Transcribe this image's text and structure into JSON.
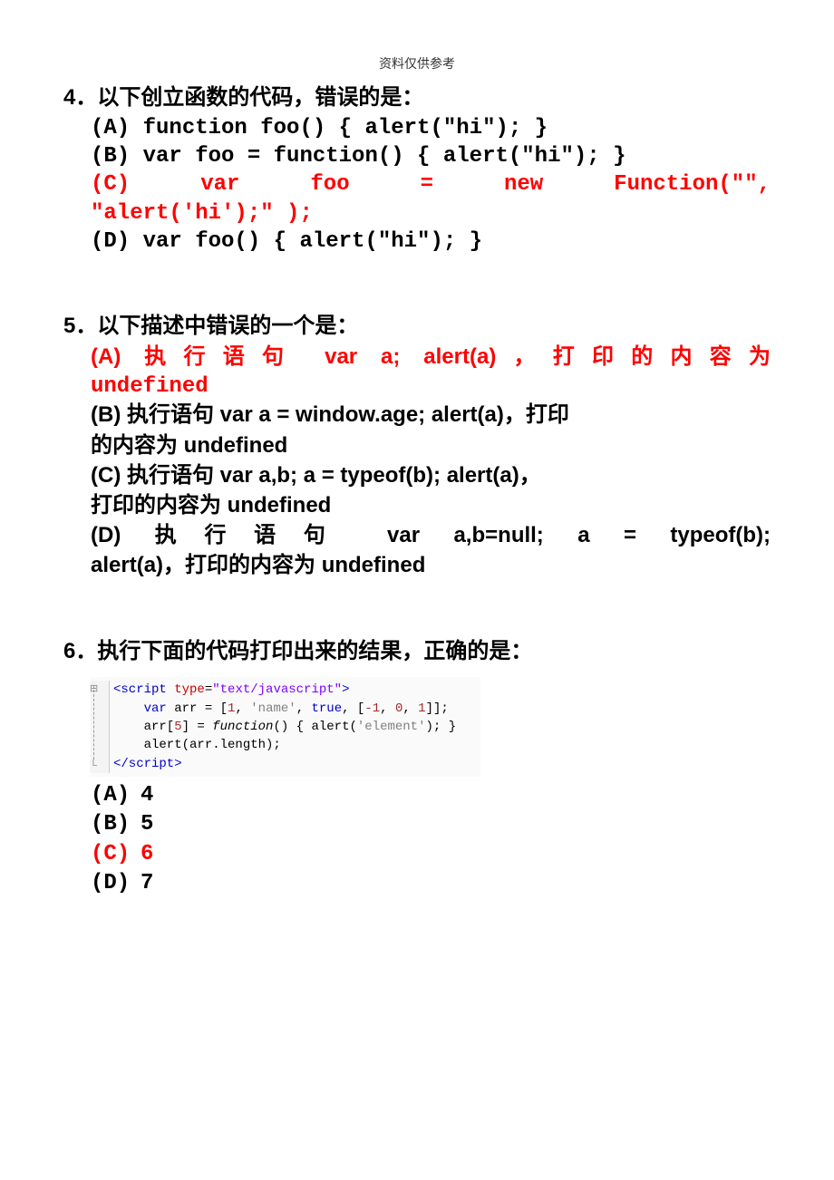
{
  "header": "资料仅供参考",
  "q4": {
    "title": "4．以下创立函数的代码，错误的是：",
    "A": "(A) function foo() { alert(\"hi\"); }",
    "B": "(B) var foo = function() { alert(\"hi\"); }",
    "C1": "(C)  var  foo  =  new  Function(\"\",",
    "C2": "\"alert('hi');\" );",
    "D": "(D) var foo() { alert(\"hi\"); }"
  },
  "q5": {
    "title": "5．以下描述中错误的一个是：",
    "A_pre": "(A) 执行语句 var a; alert(a)，打印的内容为",
    "A_suf": "undefined",
    "B1": "(B) 执行语句 var a = window.age; alert(a)，打印",
    "B2": "的内容为 undefined",
    "C1": "(C) 执行语句 var a,b; a = typeof(b); alert(a)，",
    "C2": "打印的内容为 undefined",
    "D1": "(D) 执行语句 var a,b=null; a = typeof(b);",
    "D2": "alert(a)，打印的内容为 undefined"
  },
  "q6": {
    "title": "6．执行下面的代码打印出来的结果，正确的是：",
    "code_l1_open": "<script type=",
    "code_l1_val": "\"text/javascript\"",
    "code_l1_close": ">",
    "code_l2": "    var arr = [1, 'name', true, [-1, 0, 1]];",
    "code_l3": "    arr[5] = function() { alert('element'); }",
    "code_l4": "    alert(arr.length);",
    "code_l5": "</script>",
    "A_label": "(A)",
    "A_val": "4",
    "B_label": "(B)",
    "B_val": "5",
    "C_label": "(C)",
    "C_val": "6",
    "D_label": "(D)",
    "D_val": "7"
  },
  "watermark": ""
}
